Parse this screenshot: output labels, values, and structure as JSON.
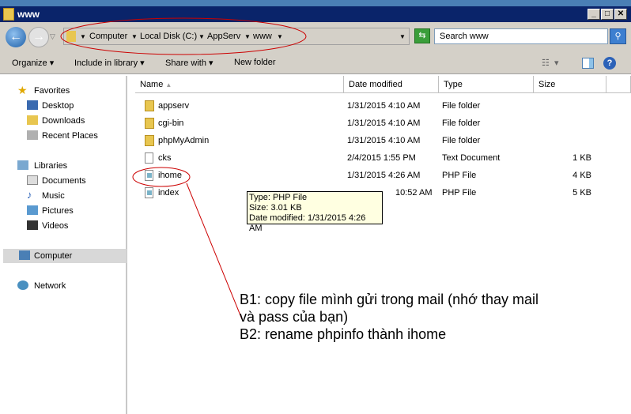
{
  "window": {
    "title": "www"
  },
  "address": {
    "crumbs": [
      "Computer",
      "Local Disk (C:)",
      "AppServ",
      "www"
    ]
  },
  "search": {
    "placeholder": "Search www"
  },
  "toolbar": {
    "organize": "Organize",
    "include": "Include in library",
    "share": "Share with",
    "new_folder": "New folder"
  },
  "sidebar": {
    "favorites": "Favorites",
    "desktop": "Desktop",
    "downloads": "Downloads",
    "recent": "Recent Places",
    "libraries": "Libraries",
    "documents": "Documents",
    "music": "Music",
    "pictures": "Pictures",
    "videos": "Videos",
    "computer": "Computer",
    "network": "Network"
  },
  "columns": {
    "name": "Name",
    "date": "Date modified",
    "type": "Type",
    "size": "Size"
  },
  "files": [
    {
      "name": "appserv",
      "date": "1/31/2015 4:10 AM",
      "type": "File folder",
      "size": "",
      "kind": "folder"
    },
    {
      "name": "cgi-bin",
      "date": "1/31/2015 4:10 AM",
      "type": "File folder",
      "size": "",
      "kind": "folder"
    },
    {
      "name": "phpMyAdmin",
      "date": "1/31/2015 4:10 AM",
      "type": "File folder",
      "size": "",
      "kind": "folder"
    },
    {
      "name": "cks",
      "date": "2/4/2015 1:55 PM",
      "type": "Text Document",
      "size": "1 KB",
      "kind": "text"
    },
    {
      "name": "ihome",
      "date": "1/31/2015 4:26 AM",
      "type": "PHP File",
      "size": "4 KB",
      "kind": "php"
    },
    {
      "name": "index",
      "date": "10:52 AM",
      "type": "PHP File",
      "size": "5 KB",
      "kind": "php"
    }
  ],
  "tooltip": {
    "line1": "Type: PHP File",
    "line2": "Size: 3.01 KB",
    "line3": "Date modified: 1/31/2015 4:26 AM"
  },
  "annotation": {
    "line1": "B1: copy file mình gửi trong mail (nhớ thay mail",
    "line2": "và pass của bạn)",
    "line3": "B2: rename phpinfo thành ihome"
  }
}
